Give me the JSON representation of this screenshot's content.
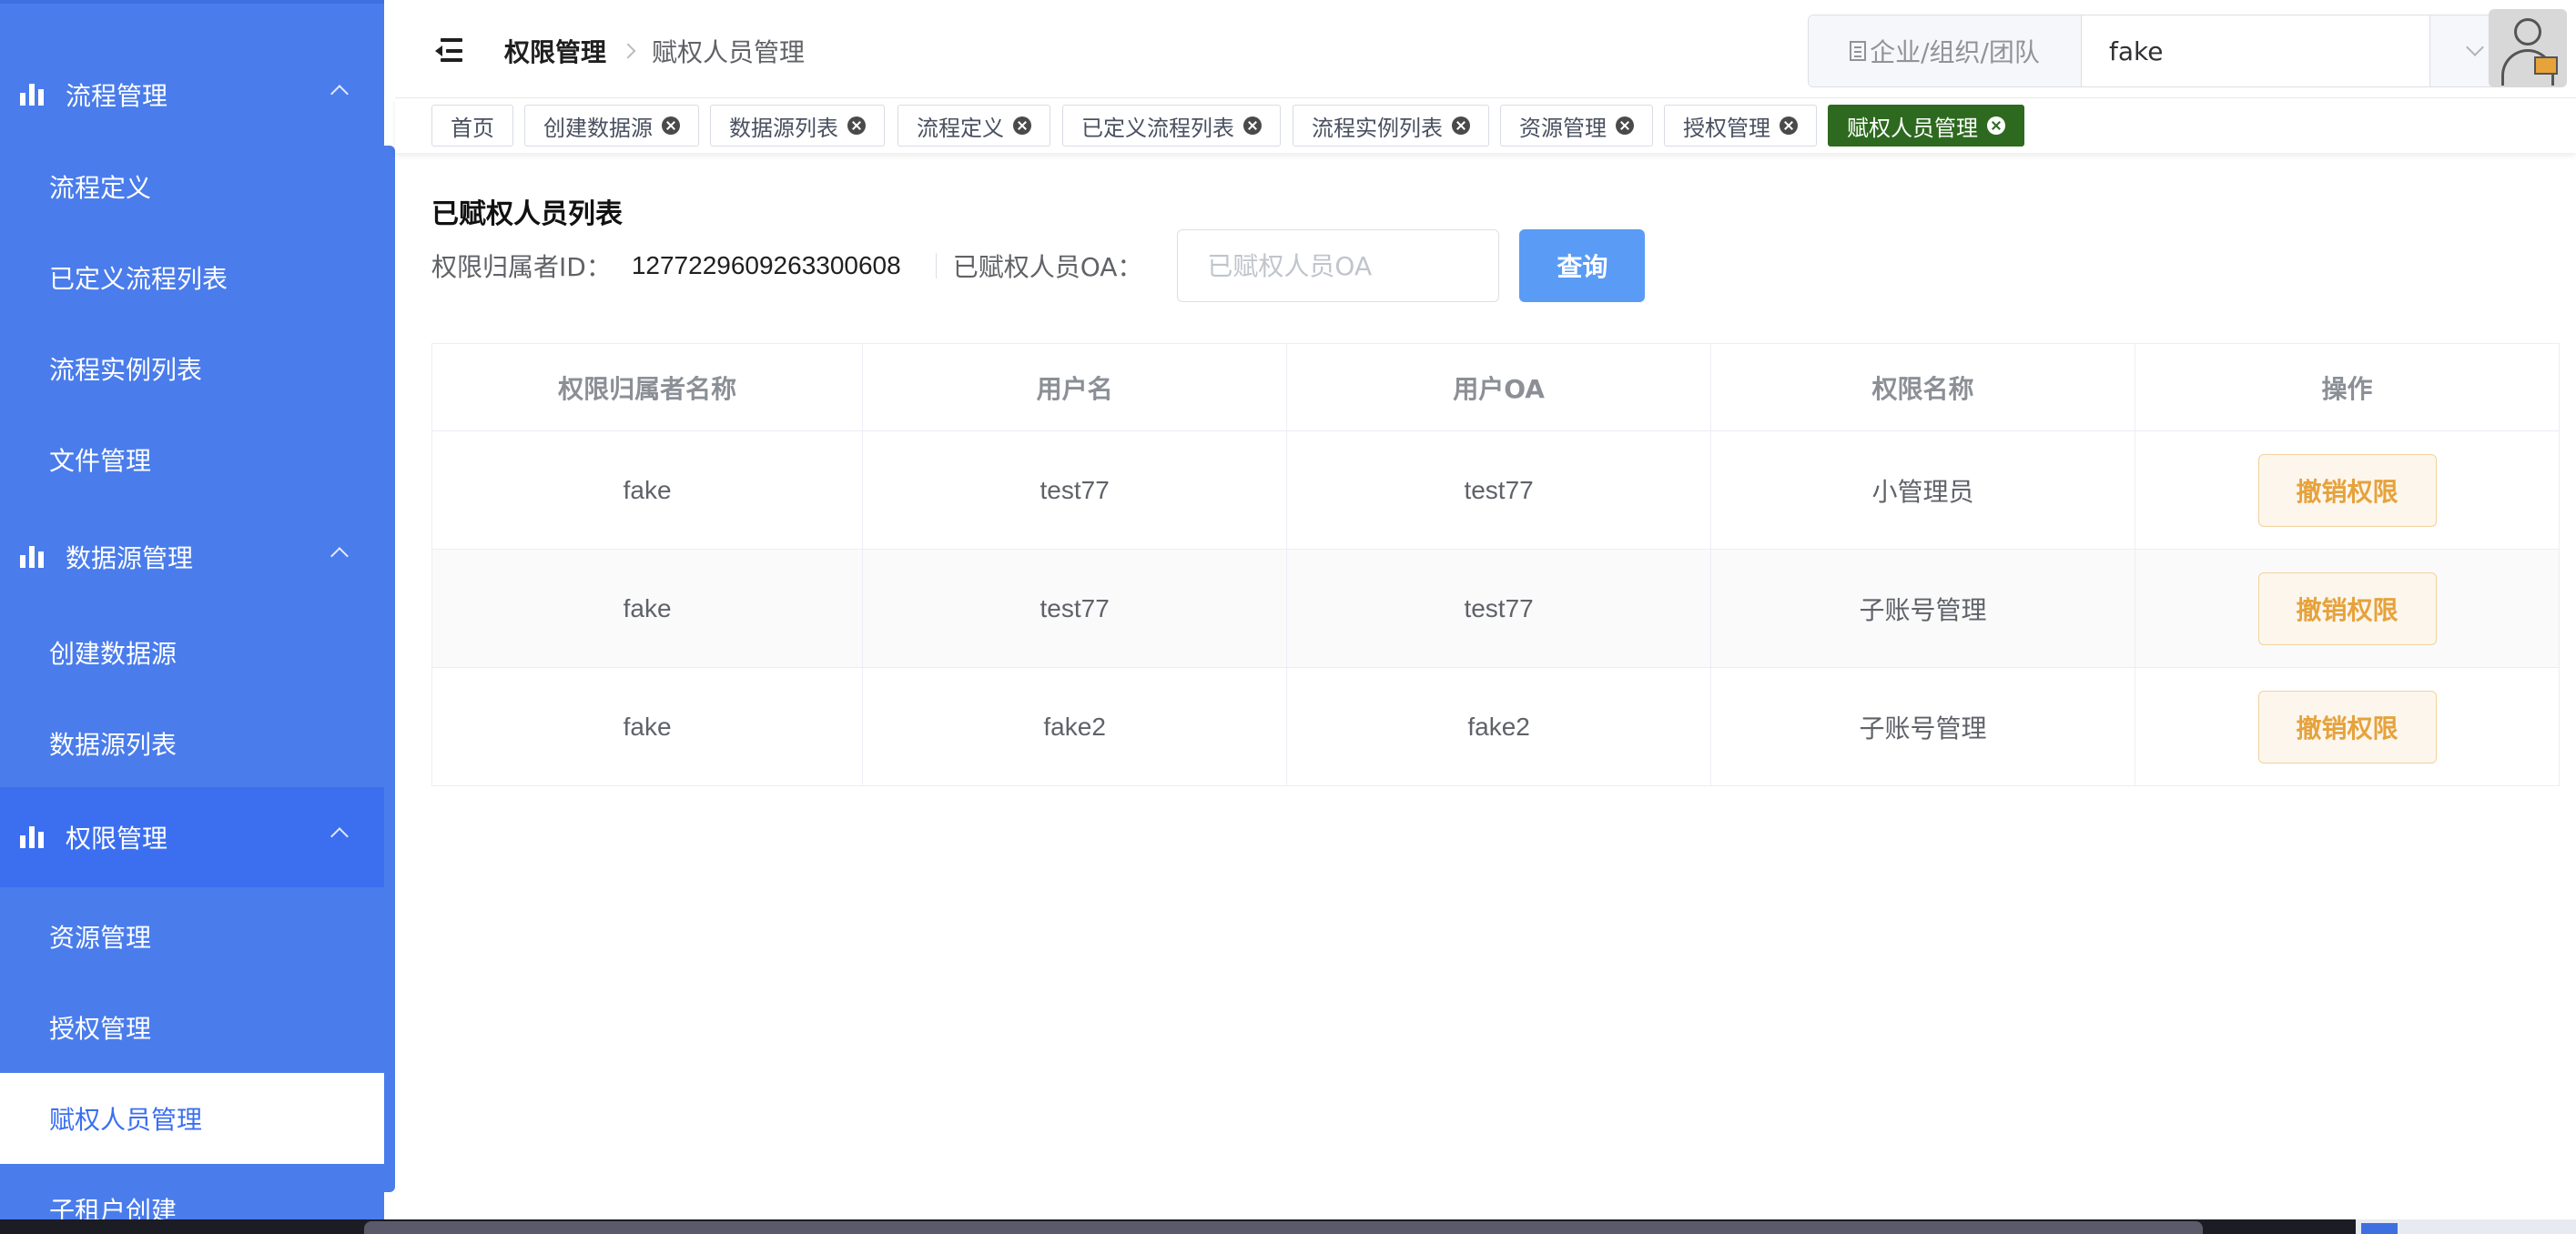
{
  "header": {
    "breadcrumb": [
      "权限管理",
      "赋权人员管理"
    ],
    "org_select": {
      "prefix": "企业/组织/团队",
      "value": "fake"
    }
  },
  "sidebar": {
    "groups": [
      {
        "label": "流程管理",
        "items": [
          "流程定义",
          "已定义流程列表",
          "流程实例列表",
          "文件管理"
        ]
      },
      {
        "label": "数据源管理",
        "items": [
          "创建数据源",
          "数据源列表"
        ]
      },
      {
        "label": "权限管理",
        "items": [
          "资源管理",
          "授权管理",
          "赋权人员管理",
          "子租户创建"
        ]
      }
    ],
    "active_item": "赋权人员管理"
  },
  "tags": [
    "首页",
    "创建数据源",
    "数据源列表",
    "流程定义",
    "已定义流程列表",
    "流程实例列表",
    "资源管理",
    "授权管理",
    "赋权人员管理"
  ],
  "active_tag": "赋权人员管理",
  "main": {
    "title": "已赋权人员列表",
    "owner_id_label": "权限归属者ID：",
    "owner_id_value": "1277229609263300608",
    "oa_label": "已赋权人员OA：",
    "oa_placeholder": "已赋权人员OA",
    "query_label": "查询"
  },
  "table": {
    "headers": [
      "权限归属者名称",
      "用户名",
      "用户OA",
      "权限名称",
      "操作"
    ],
    "rows": [
      [
        "fake",
        "test77",
        "test77",
        "小管理员"
      ],
      [
        "fake",
        "test77",
        "test77",
        "子账号管理"
      ],
      [
        "fake",
        "fake2",
        "fake2",
        "子账号管理"
      ]
    ],
    "action_label": "撤销权限"
  },
  "colors": {
    "sidebar_bg": "#4a7ceb",
    "sidebar_active_group": "#3b6ff0",
    "active_tag": "#2d6a1f",
    "primary_button": "#5a9bf5",
    "warning_text": "#e6a23c"
  }
}
